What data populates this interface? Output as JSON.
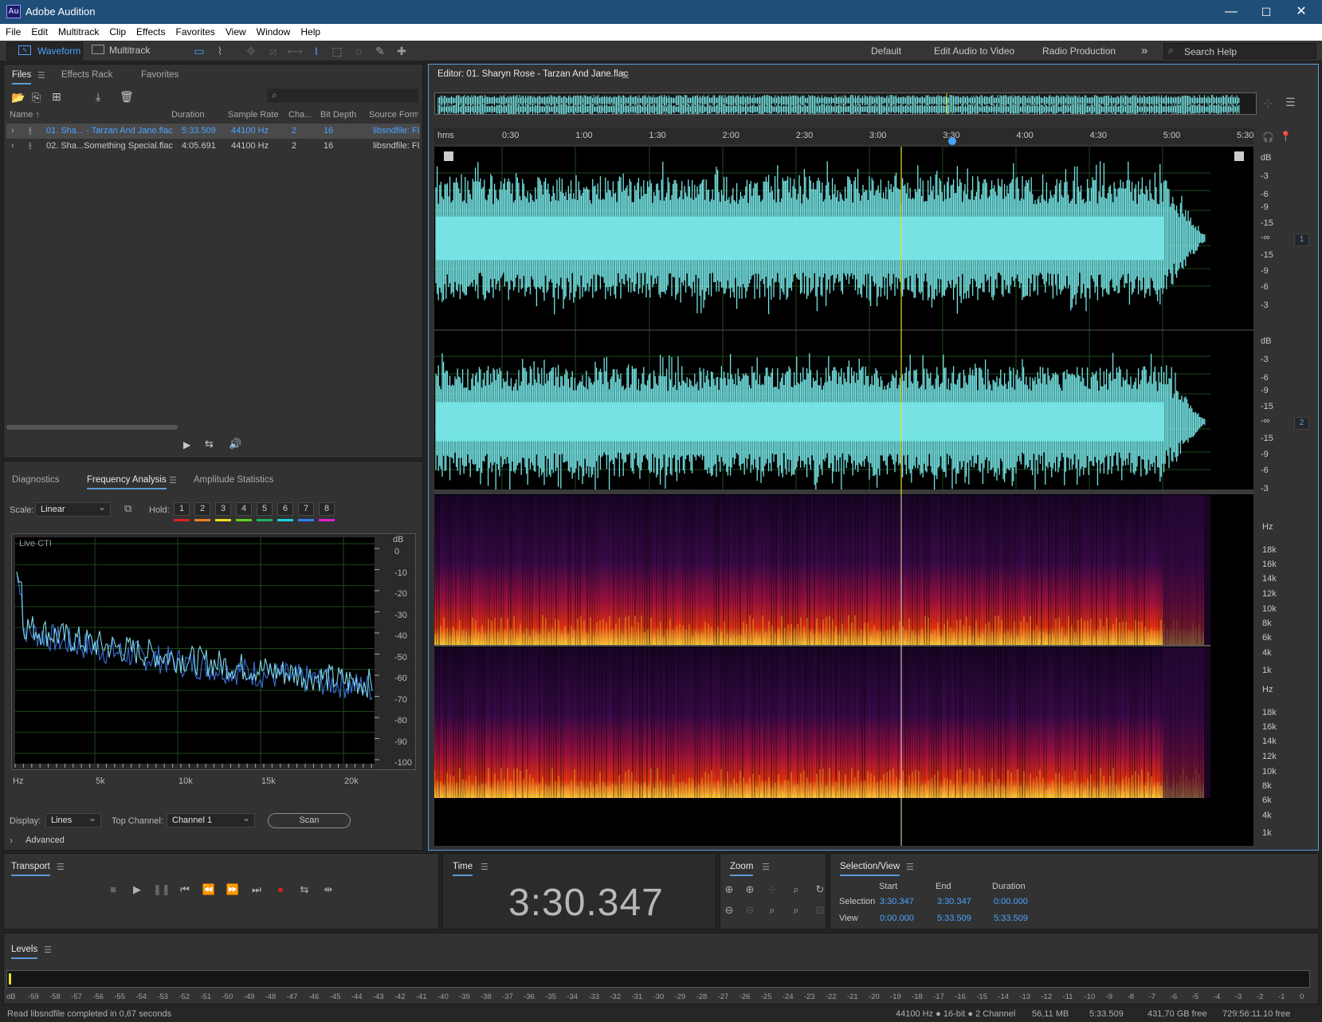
{
  "window": {
    "app_icon_text": "Au",
    "title": "Adobe Audition",
    "minimize": "—",
    "maximize": "☐",
    "close": "✕"
  },
  "menu": [
    "File",
    "Edit",
    "Multitrack",
    "Clip",
    "Effects",
    "Favorites",
    "View",
    "Window",
    "Help"
  ],
  "toolbar": {
    "waveform_label": "Waveform",
    "multitrack_label": "Multitrack",
    "workspaces": [
      "Default",
      "Edit Audio to Video",
      "Radio Production"
    ],
    "more": "»",
    "search_placeholder": "Search Help"
  },
  "files_panel": {
    "tabs": [
      "Files",
      "Effects Rack",
      "Favorites"
    ],
    "columns": [
      "Name",
      "Duration",
      "Sample Rate",
      "Cha...",
      "Bit Depth",
      "Source Format"
    ],
    "rows": [
      {
        "name": "01. Sha... - Tarzan And Jane.flac",
        "duration": "5:33.509",
        "sample_rate": "44100 Hz",
        "channels": "2",
        "bit_depth": "16",
        "source": "libsndfile: FL",
        "selected": true
      },
      {
        "name": "02. Sha...Something Special.flac",
        "duration": "4:05.691",
        "sample_rate": "44100 Hz",
        "channels": "2",
        "bit_depth": "16",
        "source": "libsndfile: FL",
        "selected": false
      }
    ]
  },
  "analysis_panel": {
    "tabs": [
      "Diagnostics",
      "Frequency Analysis",
      "Amplitude Statistics"
    ],
    "scale_label": "Scale:",
    "scale_value": "Linear",
    "hold_label": "Hold:",
    "hold_buttons": [
      "1",
      "2",
      "3",
      "4",
      "5",
      "6",
      "7",
      "8"
    ],
    "hold_colors": [
      "#e02020",
      "#f08020",
      "#e8e020",
      "#60d020",
      "#20b060",
      "#20d0e0",
      "#3080f0",
      "#e020d0"
    ],
    "live_cti": "Live CTI",
    "db_unit": "dB",
    "db_ticks": [
      "0",
      "-10",
      "-20",
      "-30",
      "-40",
      "-50",
      "-60",
      "-70",
      "-80",
      "-90",
      "-100"
    ],
    "freq_ticks": [
      "Hz",
      "5k",
      "10k",
      "15k",
      "20k"
    ],
    "display_label": "Display:",
    "display_value": "Lines",
    "top_channel_label": "Top Channel:",
    "top_channel_value": "Channel 1",
    "scan_label": "Scan",
    "advanced_label": "Advanced"
  },
  "editor": {
    "title": "Editor: 01. Sharyn Rose - Tarzan And Jane.flac",
    "ruler": [
      "hms",
      "0:30",
      "1:00",
      "1:30",
      "2:00",
      "2:30",
      "3:00",
      "3:30",
      "4:00",
      "4:30",
      "5:00",
      "5:30"
    ],
    "db_ticks": [
      "dB",
      "-3",
      "-6",
      "-9",
      "-15",
      "-∞",
      "-15",
      "-9",
      "-6",
      "-3"
    ],
    "hz_ticks": [
      "Hz",
      "18k",
      "16k",
      "14k",
      "12k",
      "10k",
      "8k",
      "6k",
      "4k",
      "1k"
    ],
    "channel_1": "1",
    "channel_2": "2"
  },
  "transport": {
    "title": "Transport"
  },
  "time": {
    "title": "Time",
    "value": "3:30.347"
  },
  "zoom": {
    "title": "Zoom"
  },
  "selection_view": {
    "title": "Selection/View",
    "headers": [
      "Start",
      "End",
      "Duration"
    ],
    "selection_label": "Selection",
    "selection": [
      "3:30.347",
      "3:30.347",
      "0:00.000"
    ],
    "view_label": "View",
    "view": [
      "0:00.000",
      "5:33.509",
      "5:33.509"
    ]
  },
  "levels": {
    "title": "Levels",
    "ticks": [
      "dB",
      "-59",
      "-58",
      "-57",
      "-56",
      "-55",
      "-54",
      "-53",
      "-52",
      "-51",
      "-50",
      "-49",
      "-48",
      "-47",
      "-46",
      "-45",
      "-44",
      "-43",
      "-42",
      "-41",
      "-40",
      "-39",
      "-38",
      "-37",
      "-36",
      "-35",
      "-34",
      "-33",
      "-32",
      "-31",
      "-30",
      "-29",
      "-28",
      "-27",
      "-26",
      "-25",
      "-24",
      "-23",
      "-22",
      "-21",
      "-20",
      "-19",
      "-18",
      "-17",
      "-16",
      "-15",
      "-14",
      "-13",
      "-12",
      "-11",
      "-10",
      "-9",
      "-8",
      "-7",
      "-6",
      "-5",
      "-4",
      "-3",
      "-2",
      "-1",
      "0"
    ]
  },
  "status": {
    "message": "Read libsndfile completed in 0,67 seconds",
    "format": "44100 Hz ● 16-bit ● 2 Channel",
    "size": "56,11 MB",
    "duration": "5:33.509",
    "disk_free": "431,70 GB free",
    "time_free": "729:56:11.10 free"
  }
}
